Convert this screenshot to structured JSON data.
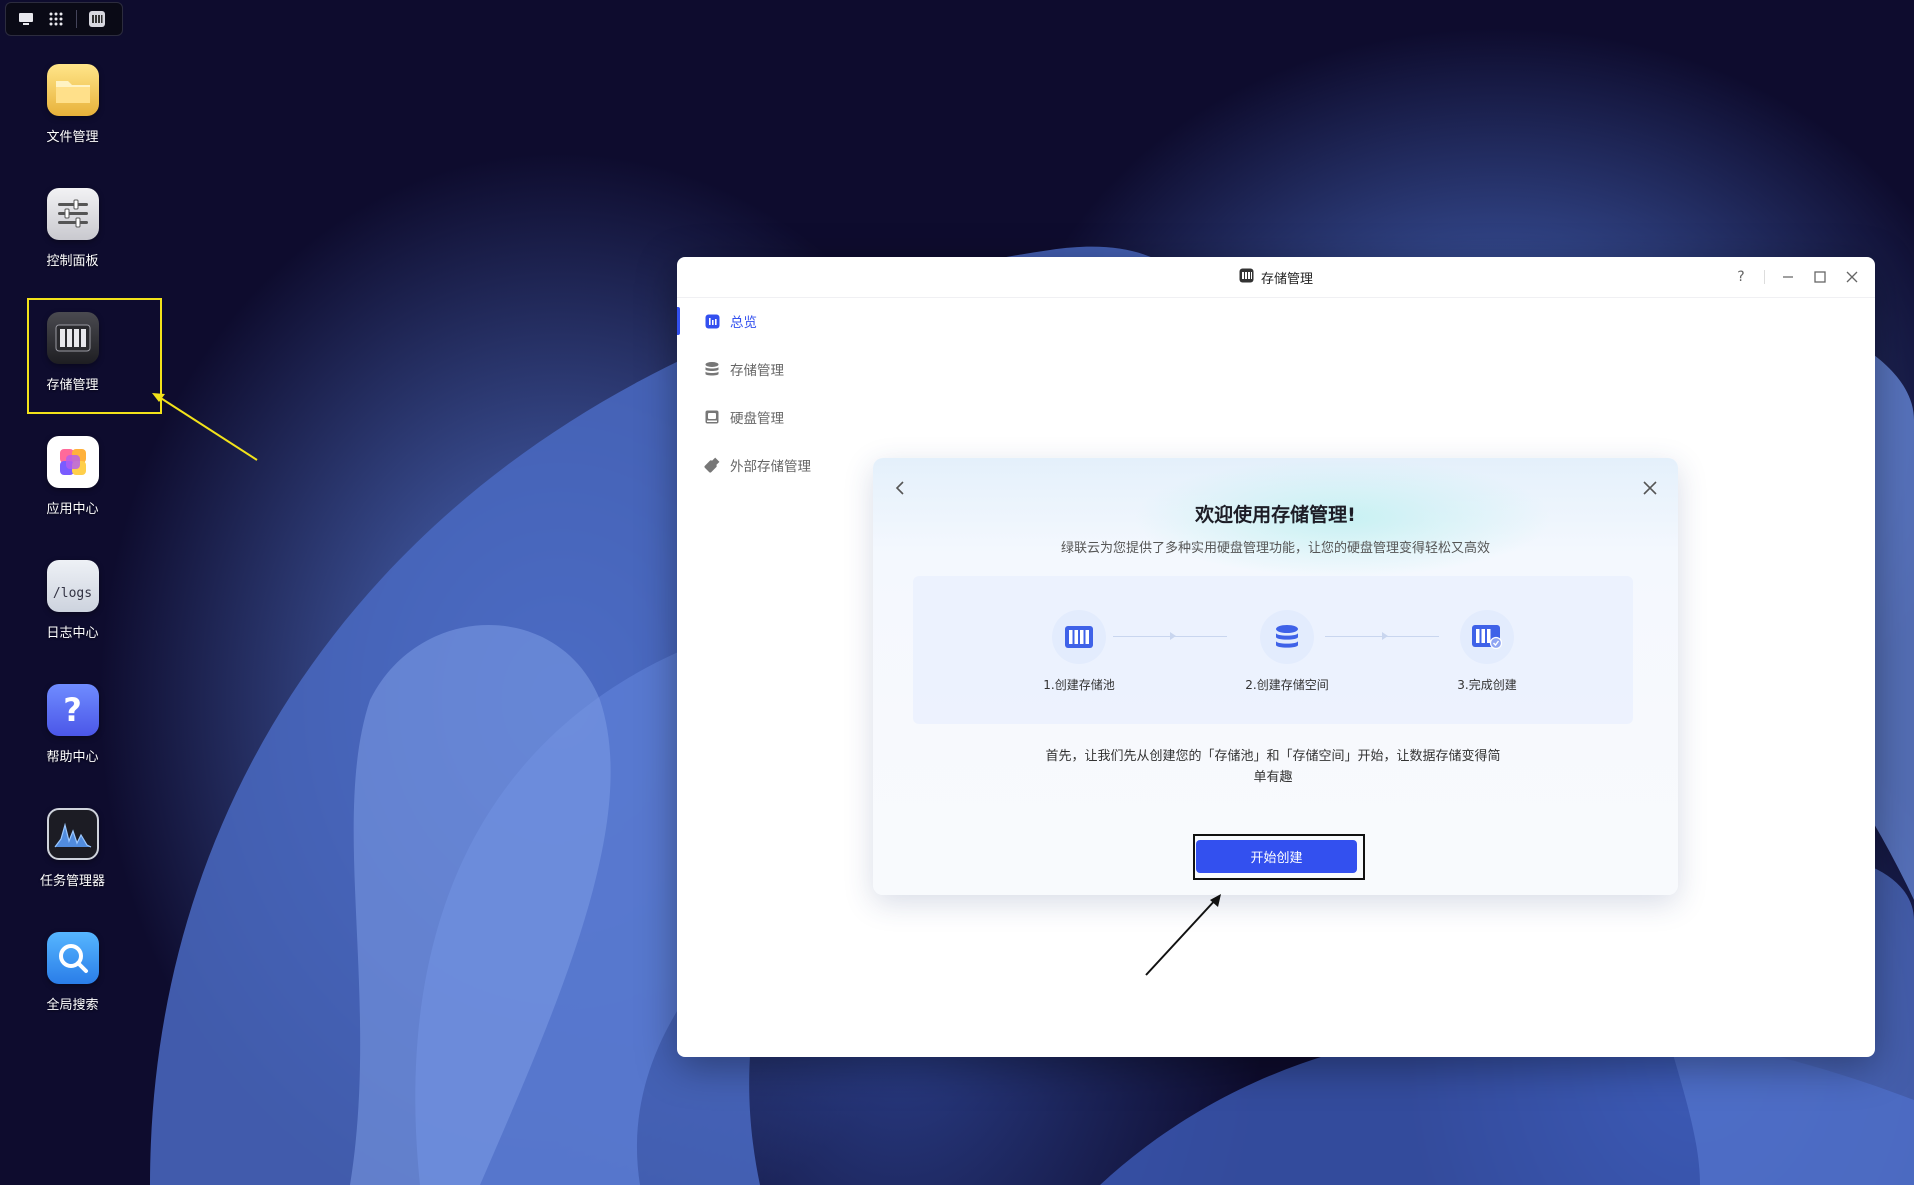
{
  "taskbar": {
    "icons": [
      "desktop-icon",
      "apps-grid-icon",
      "storage-app-icon"
    ]
  },
  "desktop": {
    "apps": [
      {
        "label": "文件管理",
        "icon": "folder-icon"
      },
      {
        "label": "控制面板",
        "icon": "sliders-icon"
      },
      {
        "label": "存储管理",
        "icon": "storage-icon"
      },
      {
        "label": "应用中心",
        "icon": "app-center-icon"
      },
      {
        "label": "日志中心",
        "icon": "logs-icon",
        "icon_text": "/logs"
      },
      {
        "label": "帮助中心",
        "icon": "help-icon",
        "icon_text": "?"
      },
      {
        "label": "任务管理器",
        "icon": "task-manager-icon"
      },
      {
        "label": "全局搜索",
        "icon": "search-icon"
      }
    ]
  },
  "window": {
    "title": "存储管理",
    "controls": {
      "help": "?"
    }
  },
  "sidebar": {
    "items": [
      {
        "label": "总览",
        "icon": "overview-icon",
        "active": true
      },
      {
        "label": "存储管理",
        "icon": "database-icon",
        "active": false
      },
      {
        "label": "硬盘管理",
        "icon": "disk-icon",
        "active": false
      },
      {
        "label": "外部存储管理",
        "icon": "usb-icon",
        "active": false
      }
    ]
  },
  "dialog": {
    "title": "欢迎使用存储管理!",
    "subtitle": "绿联云为您提供了多种实用硬盘管理功能，让您的硬盘管理变得轻松又高效",
    "steps": [
      {
        "label": "1.创建存储池",
        "icon": "storage-pool-icon"
      },
      {
        "label": "2.创建存储空间",
        "icon": "storage-space-icon"
      },
      {
        "label": "3.完成创建",
        "icon": "complete-icon"
      }
    ],
    "description": "首先，让我们先从创建您的「存储池」和「存储空间」开始，让数据存储变得简单有趣",
    "cta_label": "开始创建"
  },
  "colors": {
    "accent": "#3350ef",
    "highlight": "#f2e21a"
  }
}
